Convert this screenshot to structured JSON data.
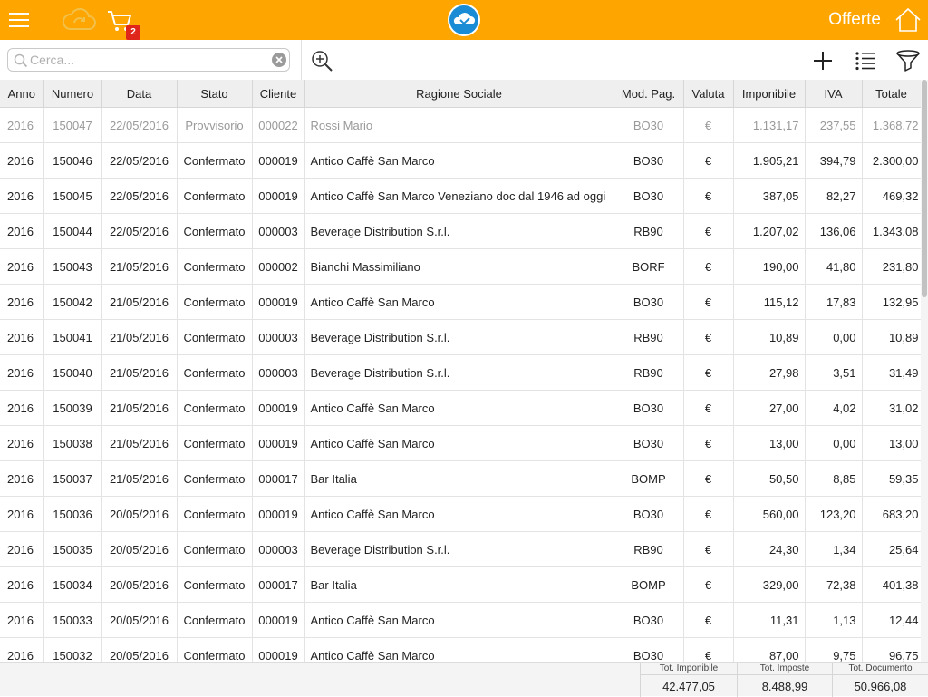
{
  "header": {
    "title": "Offerte",
    "cart_count": "2",
    "accent": "#FFA500",
    "icons": [
      "menu-icon",
      "cloud-sync-icon",
      "cart-icon",
      "cloud-logo-icon",
      "home-icon"
    ]
  },
  "toolbar": {
    "search_placeholder": "Cerca...",
    "search_value": "",
    "icons": [
      "search-icon",
      "clear-icon",
      "zoom-in-icon",
      "plus-icon",
      "list-icon",
      "filter-icon"
    ]
  },
  "table": {
    "headers": [
      "Anno",
      "Numero",
      "Data",
      "Stato",
      "Cliente",
      "Ragione Sociale",
      "Mod. Pag.",
      "Valuta",
      "Imponibile",
      "IVA",
      "Totale"
    ],
    "rows": [
      [
        "2016",
        "150047",
        "22/05/2016",
        "Provvisorio",
        "000022",
        "Rossi Mario",
        "BO30",
        "€",
        "1.131,17",
        "237,55",
        "1.368,72"
      ],
      [
        "2016",
        "150046",
        "22/05/2016",
        "Confermato",
        "000019",
        "Antico Caffè San Marco",
        "BO30",
        "€",
        "1.905,21",
        "394,79",
        "2.300,00"
      ],
      [
        "2016",
        "150045",
        "22/05/2016",
        "Confermato",
        "000019",
        "Antico Caffè San Marco Veneziano doc dal 1946 ad oggi",
        "BO30",
        "€",
        "387,05",
        "82,27",
        "469,32"
      ],
      [
        "2016",
        "150044",
        "22/05/2016",
        "Confermato",
        "000003",
        "Beverage Distribution S.r.l.",
        "RB90",
        "€",
        "1.207,02",
        "136,06",
        "1.343,08"
      ],
      [
        "2016",
        "150043",
        "21/05/2016",
        "Confermato",
        "000002",
        "Bianchi Massimiliano",
        "BORF",
        "€",
        "190,00",
        "41,80",
        "231,80"
      ],
      [
        "2016",
        "150042",
        "21/05/2016",
        "Confermato",
        "000019",
        "Antico Caffè San Marco",
        "BO30",
        "€",
        "115,12",
        "17,83",
        "132,95"
      ],
      [
        "2016",
        "150041",
        "21/05/2016",
        "Confermato",
        "000003",
        "Beverage Distribution S.r.l.",
        "RB90",
        "€",
        "10,89",
        "0,00",
        "10,89"
      ],
      [
        "2016",
        "150040",
        "21/05/2016",
        "Confermato",
        "000003",
        "Beverage Distribution S.r.l.",
        "RB90",
        "€",
        "27,98",
        "3,51",
        "31,49"
      ],
      [
        "2016",
        "150039",
        "21/05/2016",
        "Confermato",
        "000019",
        "Antico Caffè San Marco",
        "BO30",
        "€",
        "27,00",
        "4,02",
        "31,02"
      ],
      [
        "2016",
        "150038",
        "21/05/2016",
        "Confermato",
        "000019",
        "Antico Caffè San Marco",
        "BO30",
        "€",
        "13,00",
        "0,00",
        "13,00"
      ],
      [
        "2016",
        "150037",
        "21/05/2016",
        "Confermato",
        "000017",
        "Bar Italia",
        "BOMP",
        "€",
        "50,50",
        "8,85",
        "59,35"
      ],
      [
        "2016",
        "150036",
        "20/05/2016",
        "Confermato",
        "000019",
        "Antico Caffè San Marco",
        "BO30",
        "€",
        "560,00",
        "123,20",
        "683,20"
      ],
      [
        "2016",
        "150035",
        "20/05/2016",
        "Confermato",
        "000003",
        "Beverage Distribution S.r.l.",
        "RB90",
        "€",
        "24,30",
        "1,34",
        "25,64"
      ],
      [
        "2016",
        "150034",
        "20/05/2016",
        "Confermato",
        "000017",
        "Bar Italia",
        "BOMP",
        "€",
        "329,00",
        "72,38",
        "401,38"
      ],
      [
        "2016",
        "150033",
        "20/05/2016",
        "Confermato",
        "000019",
        "Antico Caffè San Marco",
        "BO30",
        "€",
        "11,31",
        "1,13",
        "12,44"
      ],
      [
        "2016",
        "150032",
        "20/05/2016",
        "Confermato",
        "000019",
        "Antico Caffè San Marco",
        "BO30",
        "€",
        "87,00",
        "9,75",
        "96,75"
      ]
    ]
  },
  "totals": {
    "imponibile_label": "Tot. Imponibile",
    "imponibile_value": "42.477,05",
    "imposte_label": "Tot. Imposte",
    "imposte_value": "8.488,99",
    "documento_label": "Tot. Documento",
    "documento_value": "50.966,08"
  }
}
